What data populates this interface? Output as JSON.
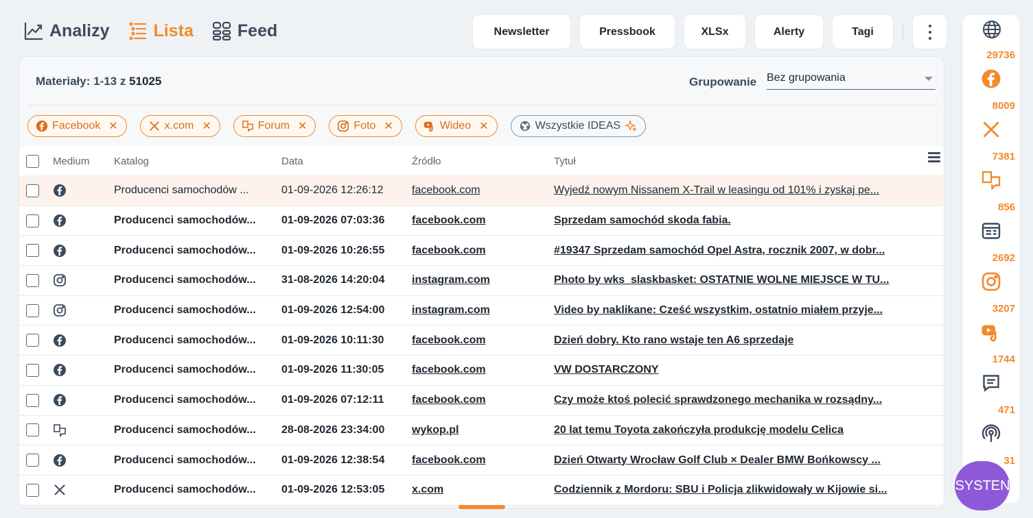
{
  "views": [
    {
      "label": "Analizy",
      "icon": "chart-line-icon",
      "active": false
    },
    {
      "label": "Lista",
      "icon": "list-icon",
      "active": true
    },
    {
      "label": "Feed",
      "icon": "grid-icon",
      "active": false
    }
  ],
  "actions": {
    "newsletter": "Newsletter",
    "pressbook": "Pressbook",
    "xlsx": "XLSx",
    "alerty": "Alerty",
    "tagi": "Tagi"
  },
  "materials": {
    "prefix": "Materiały: 1-13 z",
    "total": "51025"
  },
  "grouping": {
    "label": "Grupowanie",
    "value": "Bez grupowania"
  },
  "filters": [
    {
      "label": "Facebook",
      "icon": "facebook-icon"
    },
    {
      "label": "x.com",
      "icon": "x-icon"
    },
    {
      "label": "Forum",
      "icon": "forum-icon"
    },
    {
      "label": "Foto",
      "icon": "instagram-icon"
    },
    {
      "label": "Wideo",
      "icon": "video-icon"
    },
    {
      "label": "Wszystkie IDEAS",
      "icon": "ideas-icon"
    }
  ],
  "columns": {
    "medium": "Medium",
    "katalog": "Katalog",
    "data": "Data",
    "zrodlo": "Źródło",
    "tytul": "Tytuł"
  },
  "rows": [
    {
      "medium": "facebook-icon",
      "katalog": "Producenci samochodów ...",
      "data": "01-09-2026 12:26:12",
      "zrodlo": "facebook.com",
      "tytul": "Wyjedź nowym Nissanem X-Trail w leasingu od 101% i zyskaj pe..."
    },
    {
      "medium": "facebook-icon",
      "katalog": "Producenci samochodów...",
      "data": "01-09-2026 07:03:36",
      "zrodlo": "facebook.com",
      "tytul": "Sprzedam samochód skoda fabia."
    },
    {
      "medium": "facebook-icon",
      "katalog": "Producenci samochodów...",
      "data": "01-09-2026 10:26:55",
      "zrodlo": "facebook.com",
      "tytul": "#19347 Sprzedam samochód Opel Astra, rocznik 2007, w dobr..."
    },
    {
      "medium": "instagram-icon",
      "katalog": "Producenci samochodów...",
      "data": "31-08-2026 14:20:04",
      "zrodlo": "instagram.com",
      "tytul": "Photo by wks_slaskbasket: OSTATNIE WOLNE MIEJSCE W TU..."
    },
    {
      "medium": "instagram-icon",
      "katalog": "Producenci samochodów...",
      "data": "01-09-2026 12:54:00",
      "zrodlo": "instagram.com",
      "tytul": "Video by naklikane: Cześć wszystkim, ostatnio miałem przyje..."
    },
    {
      "medium": "facebook-icon",
      "katalog": "Producenci samochodów...",
      "data": "01-09-2026 10:11:30",
      "zrodlo": "facebook.com",
      "tytul": "Dzień dobry. Kto rano wstaje ten A6 sprzedaje"
    },
    {
      "medium": "facebook-icon",
      "katalog": "Producenci samochodów...",
      "data": "01-09-2026 11:30:05",
      "zrodlo": "facebook.com",
      "tytul": "VW DOSTARCZONY"
    },
    {
      "medium": "facebook-icon",
      "katalog": "Producenci samochodów...",
      "data": "01-09-2026 07:12:11",
      "zrodlo": "facebook.com",
      "tytul": "Czy może ktoś polecić sprawdzonego mechanika w rozsądny..."
    },
    {
      "medium": "forum-icon",
      "katalog": "Producenci samochodów...",
      "data": "28-08-2026 23:34:00",
      "zrodlo": "wykop.pl",
      "tytul": "20 lat temu Toyota zakończyła produkcję modelu Celica"
    },
    {
      "medium": "facebook-icon",
      "katalog": "Producenci samochodów...",
      "data": "01-09-2026 12:38:54",
      "zrodlo": "facebook.com",
      "tytul": "Dzień Otwarty Wrocław Golf Club × Dealer BMW Bońkowscy ..."
    },
    {
      "medium": "x-icon",
      "katalog": "Producenci samochodów...",
      "data": "01-09-2026 12:53:05",
      "zrodlo": "x.com",
      "tytul": "Codziennik z Mordoru: SBU i Policja zlikwidowały w Kijowie si..."
    }
  ],
  "rail": [
    {
      "count": "29736",
      "icon": "facebook-icon"
    },
    {
      "count": "8009",
      "icon": "x-icon"
    },
    {
      "count": "7381",
      "icon": "forum-icon"
    },
    {
      "count": "856",
      "icon": "news-icon"
    },
    {
      "count": "2692",
      "icon": "instagram-icon"
    },
    {
      "count": "3207",
      "icon": "video-icon"
    },
    {
      "count": "1744",
      "icon": "comment-icon"
    },
    {
      "count": "471",
      "icon": "podcast-icon"
    },
    {
      "count": "31",
      "icon": "other-icon"
    }
  ],
  "assistant": "ASYSTENT",
  "colors": {
    "accent": "#f28a2e",
    "assistant": "#8e59d8",
    "highlight_row": "#fdf3ec"
  }
}
